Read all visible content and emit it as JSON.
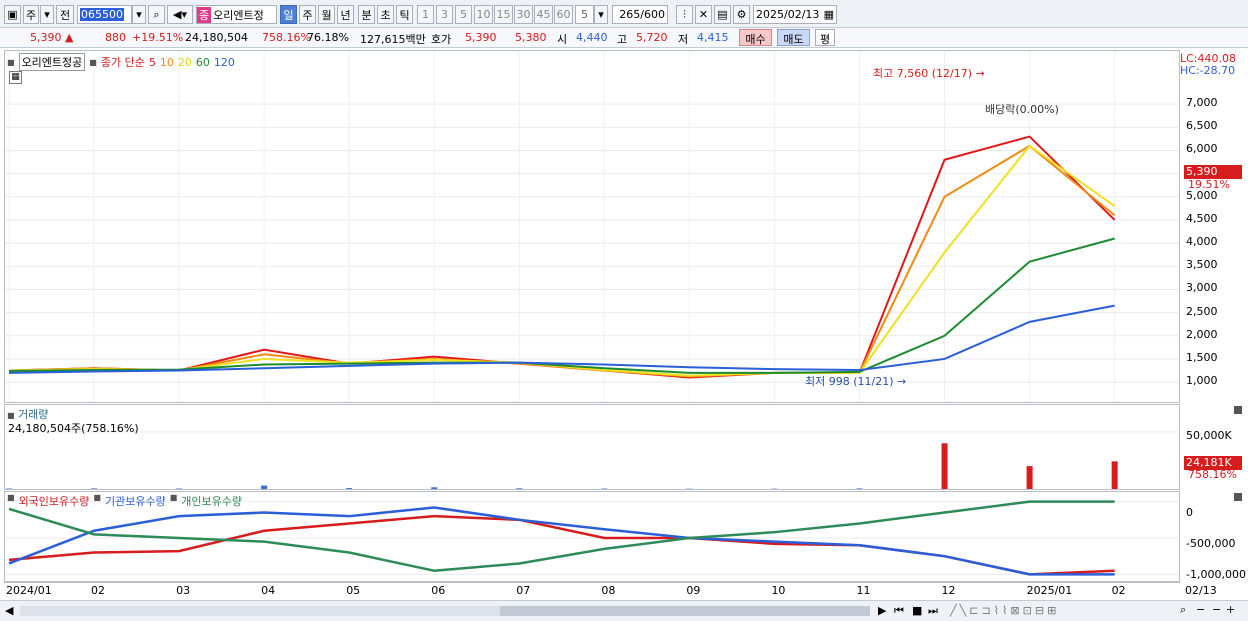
{
  "toolbar": {
    "market_mode": "주",
    "prev_label": "전",
    "stock_code": "065500",
    "stock_name": "오리엔트정",
    "jong_badge": "종",
    "periods": [
      "일",
      "주",
      "월",
      "년",
      "분",
      "초",
      "틱"
    ],
    "active_period": "일",
    "intervals": [
      "1",
      "3",
      "5",
      "10",
      "15",
      "30",
      "45",
      "60"
    ],
    "interval_value": "5",
    "count": "265",
    "count_total": "/600",
    "date": "2025/02/13"
  },
  "quote": {
    "price": "5,390",
    "change": "880",
    "change_pct": "+19.51%",
    "volume": "24,180,504",
    "volume_pct": "758.16%",
    "turnover": "76.18%",
    "amount": "127,615백만",
    "hoga_label": "호가",
    "ask": "5,390",
    "bid": "5,380",
    "open_label": "시",
    "open": "4,440",
    "high_label": "고",
    "high": "5,720",
    "low_label": "저",
    "low": "4,415",
    "buy_label": "매수",
    "sell_label": "매도",
    "avg_label": "평"
  },
  "price_panel": {
    "legend_name": "오리엔트정공",
    "legend_type": "종가 단순",
    "ma": [
      {
        "label": "5",
        "color": "#e01818"
      },
      {
        "label": "10",
        "color": "#f08a10"
      },
      {
        "label": "20",
        "color": "#f0e020"
      },
      {
        "label": "60",
        "color": "#1c8c30"
      },
      {
        "label": "120",
        "color": "#2a5fd8"
      }
    ],
    "lc": "LC:440.08",
    "hc": "HC:-28.70",
    "high_note": "최고 7,560 (12/17)",
    "low_note": "최저 998 (11/21)",
    "dividend_note": "배당락(0.00%)",
    "cur_price": "5,390",
    "cur_pct": "19.51%"
  },
  "volume_panel": {
    "title": "거래량",
    "value": "24,180,504주(758.16%)",
    "cur": "24,181K",
    "cur_pct": "758.16%"
  },
  "holding_panel": {
    "legends": [
      {
        "label": "외국인보유수량",
        "color": "#d61c1c"
      },
      {
        "label": "기관보유수량",
        "color": "#2a5fd8"
      },
      {
        "label": "개인보유수량",
        "color": "#2e8b57"
      }
    ]
  },
  "chart_data": [
    {
      "type": "line",
      "title": "오리엔트정공 종가 단순",
      "yticks": [
        "7,000",
        "6,500",
        "6,000",
        "5,500",
        "5,000",
        "4,500",
        "4,000",
        "3,500",
        "3,000",
        "2,500",
        "2,000",
        "1,500",
        "1,000"
      ],
      "ylim": [
        700,
        7500
      ],
      "x": [
        "2024/01",
        "02",
        "03",
        "04",
        "05",
        "06",
        "07",
        "08",
        "09",
        "10",
        "11",
        "12",
        "2025/01",
        "02"
      ],
      "series": [
        {
          "name": "5",
          "values": [
            1250,
            1300,
            1250,
            1700,
            1400,
            1550,
            1400,
            1250,
            1100,
            1200,
            1200,
            5800,
            6300,
            4500
          ]
        },
        {
          "name": "10",
          "values": [
            1250,
            1300,
            1250,
            1600,
            1400,
            1500,
            1400,
            1250,
            1120,
            1200,
            1200,
            5000,
            6100,
            4600
          ]
        },
        {
          "name": "20",
          "values": [
            1250,
            1280,
            1260,
            1500,
            1420,
            1480,
            1420,
            1260,
            1140,
            1200,
            1200,
            3800,
            6100,
            4800
          ]
        },
        {
          "name": "60",
          "values": [
            1240,
            1260,
            1270,
            1380,
            1400,
            1420,
            1420,
            1300,
            1200,
            1200,
            1220,
            2000,
            3600,
            4100
          ]
        },
        {
          "name": "120",
          "values": [
            1200,
            1230,
            1250,
            1300,
            1350,
            1400,
            1420,
            1380,
            1320,
            1280,
            1260,
            1500,
            2300,
            2650
          ]
        }
      ]
    },
    {
      "type": "bar",
      "title": "거래량",
      "yticks": [
        "50,000K"
      ],
      "ylim": [
        0,
        70000
      ],
      "values_k": [
        400,
        500,
        400,
        3000,
        800,
        1500,
        600,
        400,
        300,
        300,
        500,
        40000,
        20000,
        24181
      ]
    },
    {
      "type": "line",
      "yticks": [
        "0",
        "-500,000",
        "-1,000,000"
      ],
      "ylim": [
        -1050000,
        50000
      ],
      "series": [
        {
          "name": "외국인보유수량",
          "values": [
            -800000,
            -700000,
            -680000,
            -400000,
            -300000,
            -200000,
            -250000,
            -500000,
            -500000,
            -580000,
            -600000,
            -750000,
            -1000000,
            -950000
          ]
        },
        {
          "name": "기관보유수량",
          "values": [
            -850000,
            -400000,
            -200000,
            -150000,
            -200000,
            -80000,
            -250000,
            -380000,
            -500000,
            -550000,
            -600000,
            -750000,
            -1000000,
            -1000000
          ]
        },
        {
          "name": "개인보유수량",
          "values": [
            -100000,
            -450000,
            -500000,
            -550000,
            -700000,
            -950000,
            -850000,
            -650000,
            -500000,
            -420000,
            -300000,
            -150000,
            0,
            0
          ]
        }
      ]
    }
  ]
}
